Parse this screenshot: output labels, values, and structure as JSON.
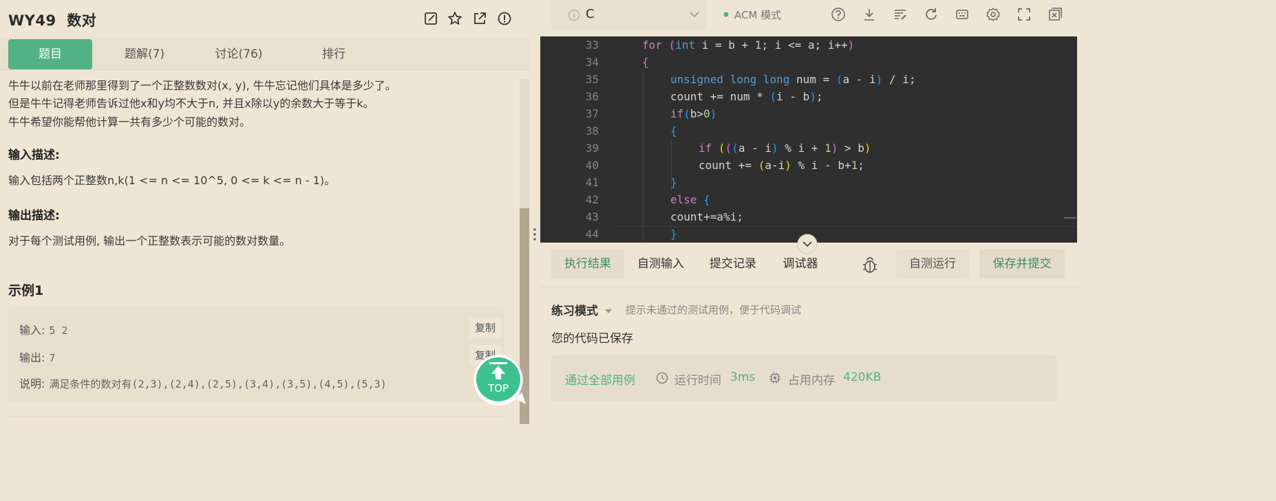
{
  "problem": {
    "title": "WY49  数对",
    "tabs": [
      "题目",
      "题解(7)",
      "讨论(76)",
      "排行"
    ],
    "desc_lines": [
      "牛牛以前在老师那里得到了一个正整数数对(x, y), 牛牛忘记他们具体是多少了。",
      "但是牛牛记得老师告诉过他x和y均不大于n, 并且x除以y的余数大于等于k。",
      "牛牛希望你能帮他计算一共有多少个可能的数对。"
    ],
    "input_title": "输入描述:",
    "input_text": "输入包括两个正整数n,k(1 <= n <= 10^5, 0 <= k <= n - 1)。",
    "output_title": "输出描述:",
    "output_text": "对于每个测试用例, 输出一个正整数表示可能的数对数量。",
    "example_title": "示例1",
    "example": {
      "input_label": "输入:",
      "input_value": "5 2",
      "output_label": "输出:",
      "output_value": "7",
      "note_label": "说明:",
      "note_value": "满足条件的数对有(2,3),(2,4),(2,5),(3,4),(3,5),(4,5),(5,3)",
      "copy_label": "复制"
    },
    "top_label": "TOP"
  },
  "editor": {
    "language": "C",
    "mode_label": "ACM 模式",
    "line_numbers": [
      "33",
      "34",
      "35",
      "36",
      "37",
      "38",
      "39",
      "40",
      "41",
      "42",
      "43",
      "44"
    ]
  },
  "result": {
    "tabs": [
      "执行结果",
      "自测输入",
      "提交记录",
      "调试器"
    ],
    "self_test_button": "自测运行",
    "submit_button": "保存并提交",
    "mode": "练习模式",
    "mode_tip": "提示未通过的测试用例，便于代码调试",
    "saved_text": "您的代码已保存",
    "pass_text": "通过全部用例",
    "time_label": "运行时间",
    "time_value": "3ms",
    "mem_label": "占用内存",
    "mem_value": "420KB"
  },
  "colors": {
    "accent": "#52b286",
    "background": "#efe5d4",
    "editor_bg": "#2f2f2f"
  }
}
